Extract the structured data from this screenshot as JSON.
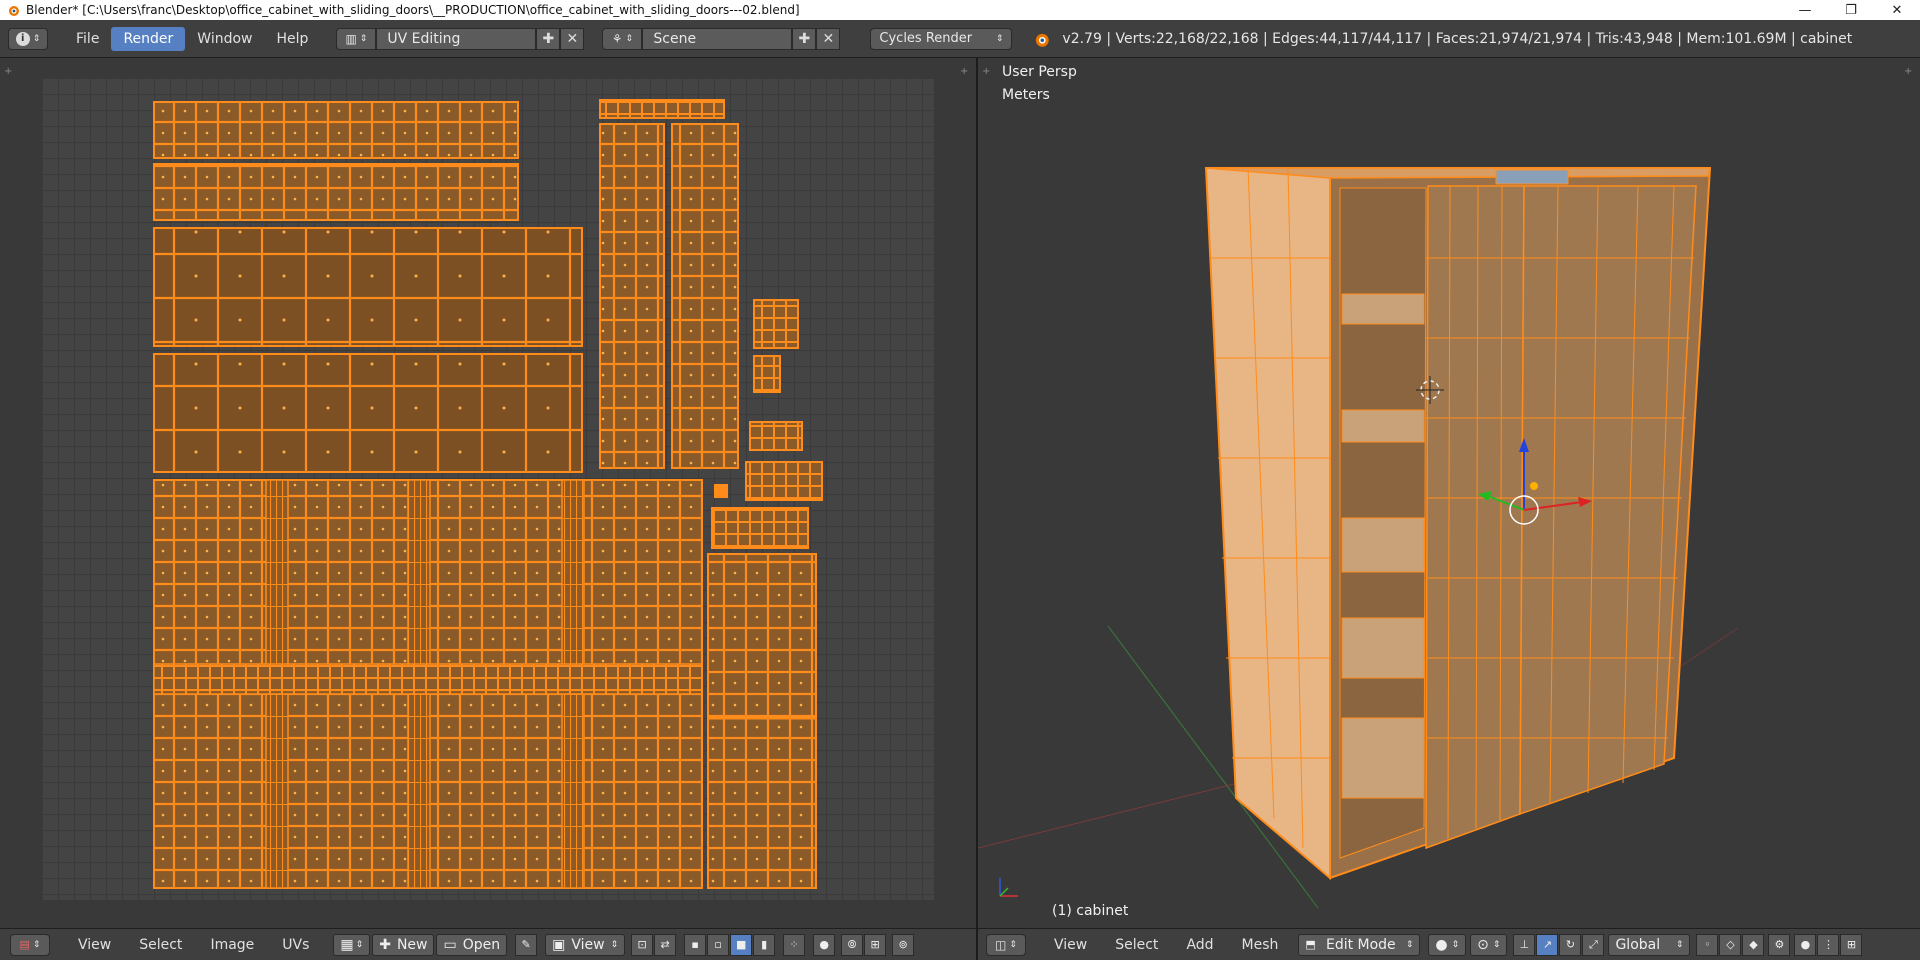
{
  "window": {
    "title": "Blender* [C:\\Users\\franc\\Desktop\\office_cabinet_with_sliding_doors\\__PRODUCTION\\office_cabinet_with_sliding_doors---02.blend]",
    "minimize": "—",
    "maximize": "❐",
    "close": "✕"
  },
  "infobar": {
    "menus": [
      "File",
      "Render",
      "Window",
      "Help"
    ],
    "active_menu": "Render",
    "screen_layout": "UV Editing",
    "scene": "Scene",
    "render_engine": "Cycles Render",
    "stats": "v2.79 | Verts:22,168/22,168 | Edges:44,117/44,117 | Faces:21,974/21,974 | Tris:43,948 | Mem:101.69M | cabinet"
  },
  "viewport": {
    "view_name": "User Persp",
    "units": "Meters",
    "object_label": "(1) cabinet"
  },
  "uv_editor_header": {
    "menus": [
      "View",
      "Select",
      "Image",
      "UVs"
    ],
    "new_label": "New",
    "open_label": "Open",
    "view_label": "View"
  },
  "view3d_header": {
    "menus": [
      "View",
      "Select",
      "Add",
      "Mesh"
    ],
    "mode": "Edit Mode",
    "orientation": "Global"
  },
  "colors": {
    "accent": "#5680c2",
    "selection": "#ff8c1a",
    "uv_face": "#8a5a28",
    "background": "#393939"
  }
}
